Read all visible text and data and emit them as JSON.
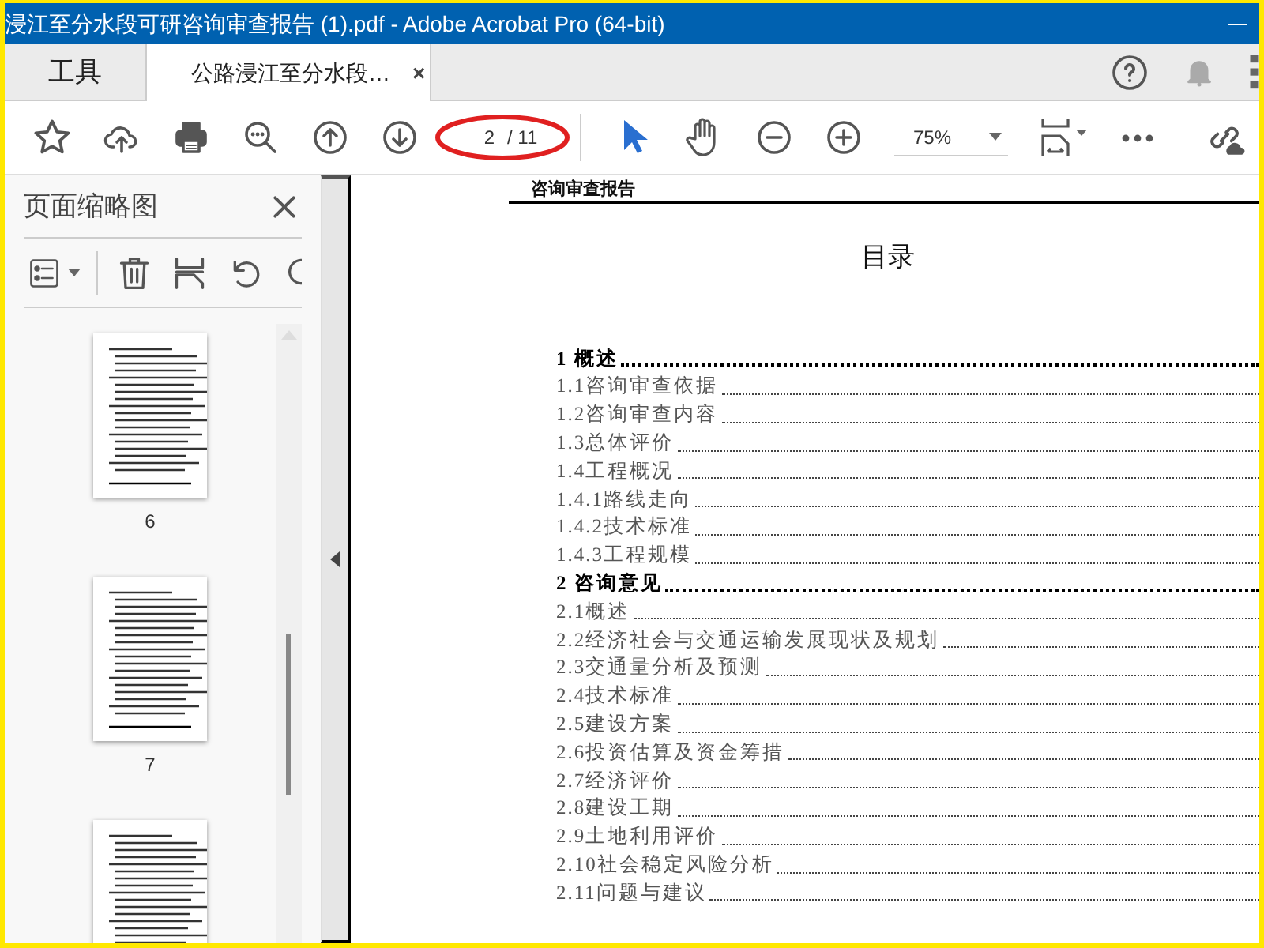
{
  "window": {
    "title": "浸江至分水段可研咨询审查报告 (1).pdf - Adobe Acrobat Pro (64-bit)"
  },
  "tabs": [
    {
      "label": "工具",
      "selected": false
    },
    {
      "label": "公路浸江至分水段…",
      "selected": true,
      "close_glyph": "×"
    }
  ],
  "toolbar": {
    "page_field": {
      "value": "2"
    },
    "page_total": "/ 11",
    "zoom": "75%",
    "tools": [
      {
        "kind": "select",
        "selected": true
      },
      {
        "kind": "hand",
        "selected": false
      }
    ]
  },
  "sidebar": {
    "title": "页面缩略图",
    "thumbnails": [
      {
        "label": "6",
        "cut_off": false
      },
      {
        "label": "7",
        "cut_off": false
      },
      {
        "cut_off": true
      }
    ]
  },
  "document": {
    "header": "咨询审查报告",
    "heading": "目录",
    "toc": [
      {
        "text": "1 概述",
        "kind": "chapter"
      },
      {
        "text": "1.1咨询审查依据",
        "kind": "section"
      },
      {
        "text": "1.2咨询审查内容",
        "kind": "section"
      },
      {
        "text": "1.3总体评价",
        "kind": "section"
      },
      {
        "text": "1.4工程概况",
        "kind": "section"
      },
      {
        "text": "1.4.1路线走向",
        "kind": "section"
      },
      {
        "text": "1.4.2技术标准",
        "kind": "section"
      },
      {
        "text": "1.4.3工程规模",
        "kind": "section"
      },
      {
        "text": "2 咨询意见",
        "kind": "chapter"
      },
      {
        "text": "2.1概述",
        "kind": "section"
      },
      {
        "text": "2.2经济社会与交通运输发展现状及规划",
        "kind": "section"
      },
      {
        "text": "2.3交通量分析及预测",
        "kind": "section"
      },
      {
        "text": "2.4技术标准",
        "kind": "section"
      },
      {
        "text": "2.5建设方案",
        "kind": "section"
      },
      {
        "text": "2.6投资估算及资金筹措",
        "kind": "section"
      },
      {
        "text": "2.7经济评价",
        "kind": "section"
      },
      {
        "text": "2.8建设工期",
        "kind": "section"
      },
      {
        "text": "2.9土地利用评价",
        "kind": "section"
      },
      {
        "text": "2.10社会稳定风险分析",
        "kind": "section"
      },
      {
        "text": "2.11问题与建议",
        "kind": "section"
      }
    ]
  }
}
